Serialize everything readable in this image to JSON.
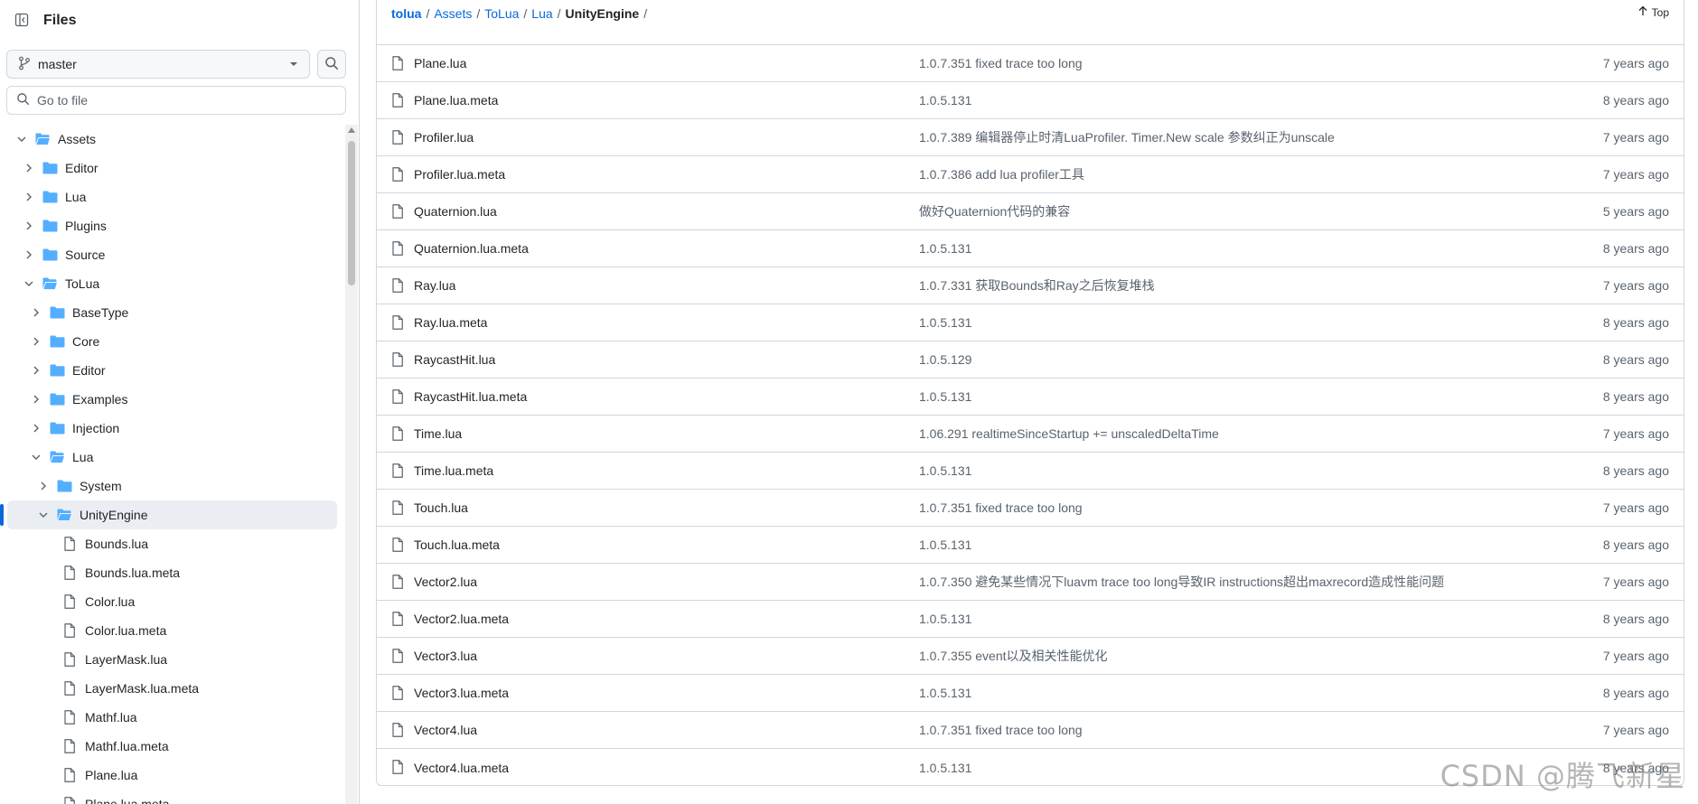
{
  "sidebar": {
    "title": "Files",
    "branch": "master",
    "goto_placeholder": "Go to file",
    "tree": [
      {
        "label": "Assets",
        "depth": 0,
        "kind": "folder",
        "expanded": true,
        "selected": false
      },
      {
        "label": "Editor",
        "depth": 1,
        "kind": "folder",
        "expanded": false,
        "selected": false
      },
      {
        "label": "Lua",
        "depth": 1,
        "kind": "folder",
        "expanded": false,
        "selected": false
      },
      {
        "label": "Plugins",
        "depth": 1,
        "kind": "folder",
        "expanded": false,
        "selected": false
      },
      {
        "label": "Source",
        "depth": 1,
        "kind": "folder",
        "expanded": false,
        "selected": false
      },
      {
        "label": "ToLua",
        "depth": 1,
        "kind": "folder",
        "expanded": true,
        "selected": false
      },
      {
        "label": "BaseType",
        "depth": 2,
        "kind": "folder",
        "expanded": false,
        "selected": false
      },
      {
        "label": "Core",
        "depth": 2,
        "kind": "folder",
        "expanded": false,
        "selected": false
      },
      {
        "label": "Editor",
        "depth": 2,
        "kind": "folder",
        "expanded": false,
        "selected": false
      },
      {
        "label": "Examples",
        "depth": 2,
        "kind": "folder",
        "expanded": false,
        "selected": false
      },
      {
        "label": "Injection",
        "depth": 2,
        "kind": "folder",
        "expanded": false,
        "selected": false
      },
      {
        "label": "Lua",
        "depth": 2,
        "kind": "folder",
        "expanded": true,
        "selected": false
      },
      {
        "label": "System",
        "depth": 3,
        "kind": "folder",
        "expanded": false,
        "selected": false
      },
      {
        "label": "UnityEngine",
        "depth": 3,
        "kind": "folder",
        "expanded": true,
        "selected": true
      },
      {
        "label": "Bounds.lua",
        "depth": 4,
        "kind": "file",
        "selected": false
      },
      {
        "label": "Bounds.lua.meta",
        "depth": 4,
        "kind": "file",
        "selected": false
      },
      {
        "label": "Color.lua",
        "depth": 4,
        "kind": "file",
        "selected": false
      },
      {
        "label": "Color.lua.meta",
        "depth": 4,
        "kind": "file",
        "selected": false
      },
      {
        "label": "LayerMask.lua",
        "depth": 4,
        "kind": "file",
        "selected": false
      },
      {
        "label": "LayerMask.lua.meta",
        "depth": 4,
        "kind": "file",
        "selected": false
      },
      {
        "label": "Mathf.lua",
        "depth": 4,
        "kind": "file",
        "selected": false
      },
      {
        "label": "Mathf.lua.meta",
        "depth": 4,
        "kind": "file",
        "selected": false
      },
      {
        "label": "Plane.lua",
        "depth": 4,
        "kind": "file",
        "selected": false
      },
      {
        "label": "Plane.lua.meta",
        "depth": 4,
        "kind": "file",
        "selected": false
      }
    ]
  },
  "breadcrumb": {
    "items": [
      "tolua",
      "Assets",
      "ToLua",
      "Lua",
      "UnityEngine"
    ],
    "trailing_sep": "/",
    "top_label": "Top"
  },
  "files": [
    {
      "name": "Plane.lua",
      "message": "1.0.7.351 fixed trace too long",
      "age": "7 years ago"
    },
    {
      "name": "Plane.lua.meta",
      "message": "1.0.5.131",
      "age": "8 years ago"
    },
    {
      "name": "Profiler.lua",
      "message": "1.0.7.389 编辑器停止时清LuaProfiler. Timer.New scale 参数纠正为unscale",
      "age": "7 years ago"
    },
    {
      "name": "Profiler.lua.meta",
      "message": "1.0.7.386 add lua profiler工具",
      "age": "7 years ago"
    },
    {
      "name": "Quaternion.lua",
      "message": "做好Quaternion代码的兼容",
      "age": "5 years ago"
    },
    {
      "name": "Quaternion.lua.meta",
      "message": "1.0.5.131",
      "age": "8 years ago"
    },
    {
      "name": "Ray.lua",
      "message": "1.0.7.331 获取Bounds和Ray之后恢复堆栈",
      "age": "7 years ago"
    },
    {
      "name": "Ray.lua.meta",
      "message": "1.0.5.131",
      "age": "8 years ago"
    },
    {
      "name": "RaycastHit.lua",
      "message": "1.0.5.129",
      "age": "8 years ago"
    },
    {
      "name": "RaycastHit.lua.meta",
      "message": "1.0.5.131",
      "age": "8 years ago"
    },
    {
      "name": "Time.lua",
      "message": "1.06.291 realtimeSinceStartup += unscaledDeltaTime",
      "age": "7 years ago"
    },
    {
      "name": "Time.lua.meta",
      "message": "1.0.5.131",
      "age": "8 years ago"
    },
    {
      "name": "Touch.lua",
      "message": "1.0.7.351 fixed trace too long",
      "age": "7 years ago"
    },
    {
      "name": "Touch.lua.meta",
      "message": "1.0.5.131",
      "age": "8 years ago"
    },
    {
      "name": "Vector2.lua",
      "message": "1.0.7.350 避免某些情况下luavm trace too long导致IR instructions超出maxrecord造成性能问题",
      "age": "7 years ago"
    },
    {
      "name": "Vector2.lua.meta",
      "message": "1.0.5.131",
      "age": "8 years ago"
    },
    {
      "name": "Vector3.lua",
      "message": "1.0.7.355 event以及相关性能优化",
      "age": "7 years ago"
    },
    {
      "name": "Vector3.lua.meta",
      "message": "1.0.5.131",
      "age": "8 years ago"
    },
    {
      "name": "Vector4.lua",
      "message": "1.0.7.351 fixed trace too long",
      "age": "7 years ago"
    },
    {
      "name": "Vector4.lua.meta",
      "message": "1.0.5.131",
      "age": "8 years ago"
    }
  ],
  "watermark": "CSDN @腾飞新星",
  "colors": {
    "accent": "#0969da",
    "folder": "#54aeff",
    "border": "#d0d7de",
    "muted": "#59636e"
  },
  "icons": {
    "panel": "sidebar-collapse-icon",
    "branch": "git-branch-icon",
    "search": "search-icon",
    "folder": "folder-icon",
    "file": "file-icon",
    "chevron": "chevron-icon",
    "top": "arrow-up-icon"
  }
}
